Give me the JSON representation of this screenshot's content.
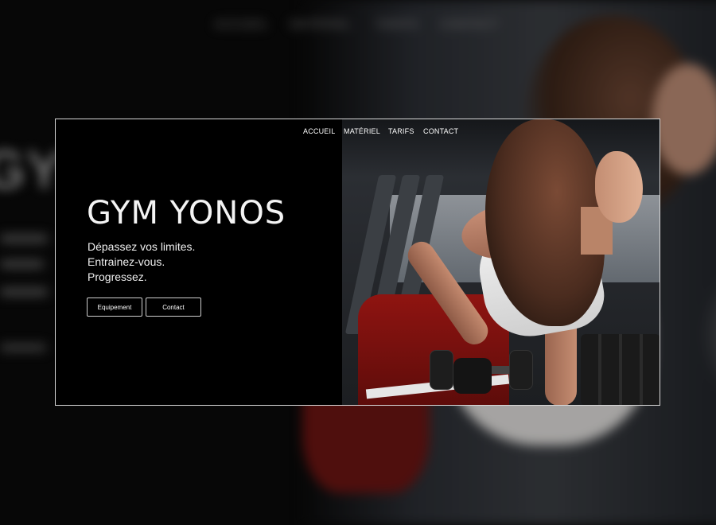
{
  "nav": {
    "items": [
      {
        "label": "ACCUEIL"
      },
      {
        "label": "MATÉRIEL"
      },
      {
        "label": "TARIFS"
      },
      {
        "label": "CONTACT"
      }
    ]
  },
  "hero": {
    "title": "GYM YONOS",
    "tagline_lines": [
      "Dépassez vos limites.",
      "Entrainez-vous.",
      "Progressez."
    ],
    "buttons": [
      {
        "label": "Equipement"
      },
      {
        "label": "Contact"
      }
    ]
  },
  "colors": {
    "background": "#000000",
    "text": "#ffffff",
    "button_border": "#cfcfcf",
    "card_border": "#d9d9d9"
  }
}
